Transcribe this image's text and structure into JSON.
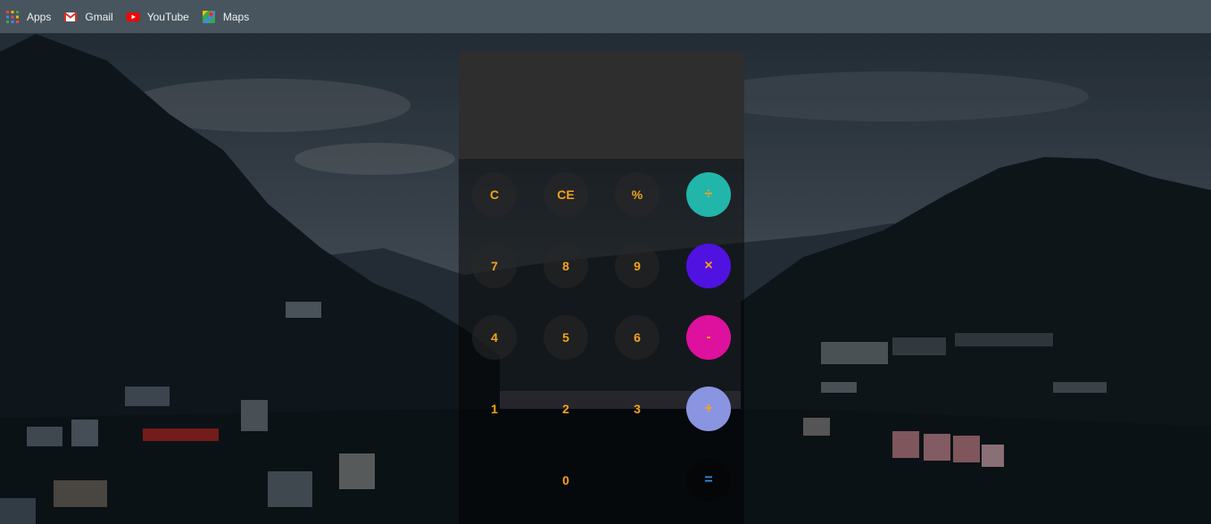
{
  "bookmarks": [
    {
      "label": "Apps",
      "icon": "apps-grid-icon"
    },
    {
      "label": "Gmail",
      "icon": "gmail-icon"
    },
    {
      "label": "YouTube",
      "icon": "youtube-icon"
    },
    {
      "label": "Maps",
      "icon": "maps-icon"
    }
  ],
  "calculator": {
    "display": {
      "previous": "",
      "current": ""
    },
    "keys": {
      "clear": "C",
      "clear_entry": "CE",
      "percent": "%",
      "divide": "÷",
      "seven": "7",
      "eight": "8",
      "nine": "9",
      "multiply": "×",
      "four": "4",
      "five": "5",
      "six": "6",
      "subtract": "-",
      "one": "1",
      "two": "2",
      "three": "3",
      "add": "+",
      "zero": "0",
      "equals": "="
    }
  },
  "colors": {
    "key_text": "#f3a21c",
    "divide_bg": "#22b5aa",
    "multiply_bg": "#5012e0",
    "subtract_bg": "#de109e",
    "add_bg": "#8a95e2",
    "equals_text": "#2f8fe8",
    "bookmarks_bar": "#48555e",
    "display_bg": "#2f2e2e"
  }
}
